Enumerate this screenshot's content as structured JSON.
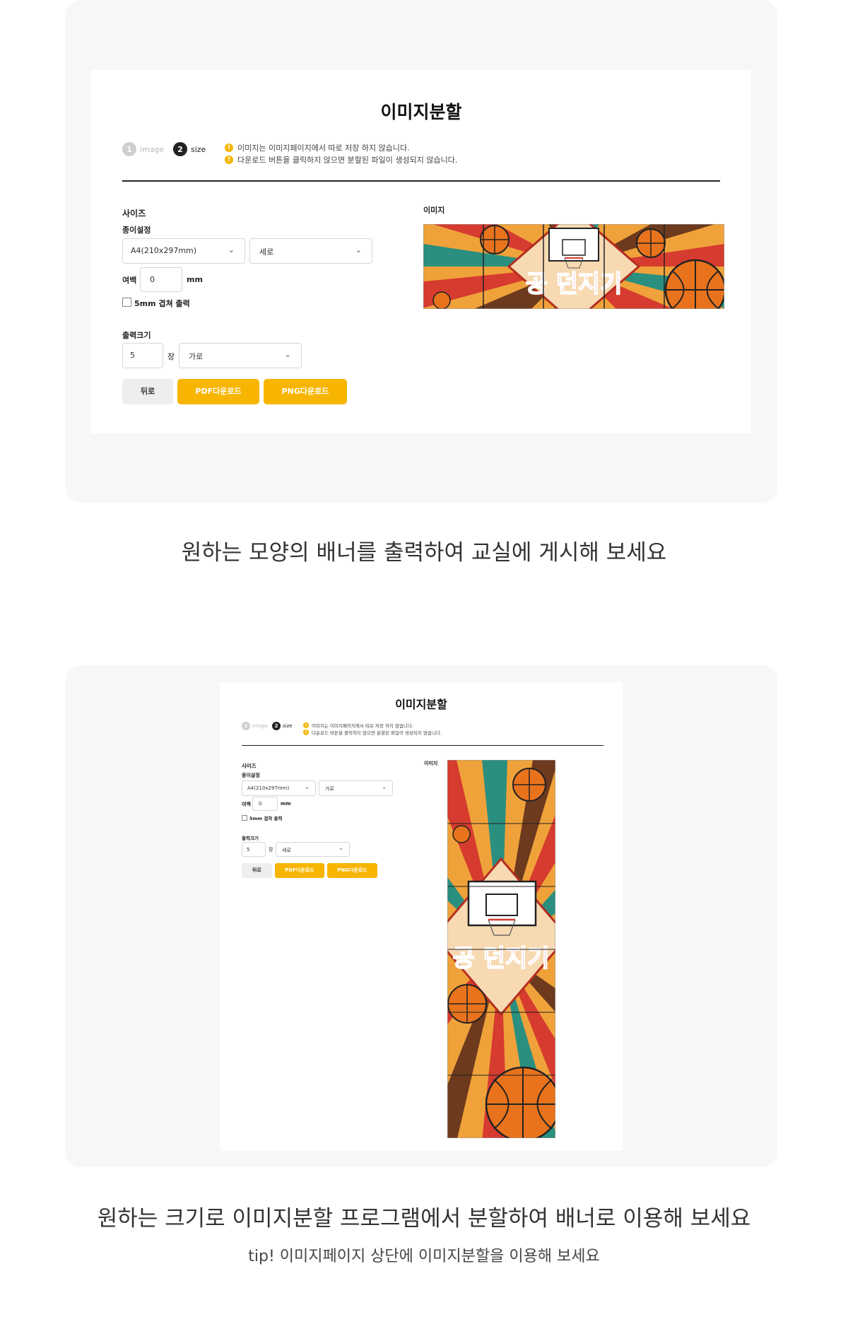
{
  "section1": {
    "title": "이미지분할",
    "steps": [
      {
        "num": "1",
        "label": "image"
      },
      {
        "num": "2",
        "label": "size"
      }
    ],
    "notices": [
      "이미지는 이미지페이지에서 따로 저장 하지 않습니다.",
      "다운로드 버튼을 클릭하지 않으면 분할된 파일이 생성되지 않습니다."
    ],
    "size_heading": "사이즈",
    "paper_label": "종이설정",
    "paper_select": "A4(210x297mm)",
    "orientation_select": "세로",
    "margin_label": "여백",
    "margin_value": "0",
    "margin_unit": "mm",
    "overlap_label": "5mm 겹쳐 출력",
    "output_label": "출력크기",
    "output_count": "5",
    "output_unit": "장",
    "output_dir": "가로",
    "back_button": "뒤로",
    "pdf_button": "PDF다운로드",
    "png_button": "PNG다운로드",
    "image_heading": "이미지",
    "banner_text": "공 던지기"
  },
  "caption1": "원하는 모양의 배너를 출력하여 교실에 게시해 보세요",
  "section2": {
    "title": "이미지분할",
    "steps": [
      {
        "num": "1",
        "label": "image"
      },
      {
        "num": "2",
        "label": "size"
      }
    ],
    "notices": [
      "이미지는 이미지페이지에서 따로 저장 하지 않습니다.",
      "다운로드 버튼을 클릭하지 않으면 분할된 파일이 생성되지 않습니다."
    ],
    "size_heading": "사이즈",
    "paper_label": "종이설정",
    "paper_select": "A4(210x297mm)",
    "orientation_select": "가로",
    "margin_label": "여백",
    "margin_value": "0",
    "margin_unit": "mm",
    "overlap_label": "5mm 겹쳐 출력",
    "output_label": "출력크기",
    "output_count": "5",
    "output_unit": "장",
    "output_dir": "세로",
    "back_button": "뒤로",
    "pdf_button": "PDF다운로드",
    "png_button": "PNG다운로드",
    "image_heading": "이미지",
    "banner_text": "공 던지기"
  },
  "caption2": "원하는 크기로 이미지분할 프로그램에서 분할하여 배너로 이용해 보세요",
  "tip": "tip! 이미지페이지 상단에 이미지분할을 이용해 보세요",
  "colors": {
    "accent": "#f7b500",
    "card_bg": "#f7f7f7",
    "dark": "#222222",
    "ball": "#e8731c"
  }
}
